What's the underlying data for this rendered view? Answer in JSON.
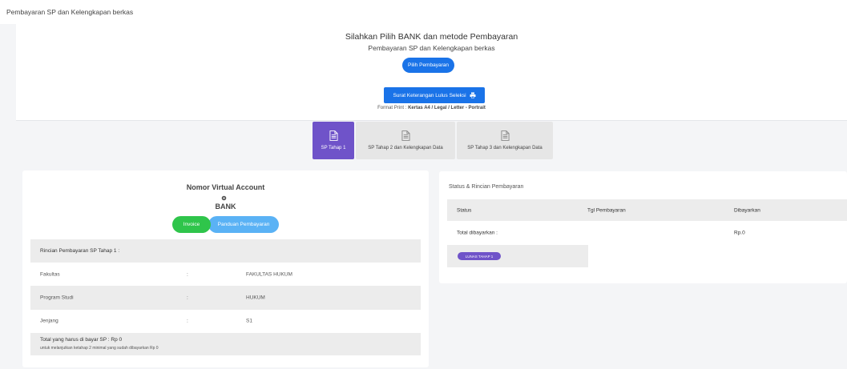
{
  "page": {
    "title": "Pembayaran SP dan Kelengkapan berkas"
  },
  "header": {
    "heading": "Silahkan Pilih BANK dan metode Pembayaran",
    "subheading": "Pembayaran SP dan Kelengkapan berkas",
    "choose_button": "Pilih Pembayaran",
    "print_button": "Surat Keterangan Lulus Seleksi",
    "format_label": "Format Print :",
    "format_value": "Kertas A4 / Legal / Letter - Portrait"
  },
  "tabs": [
    {
      "label": "SP Tahap 1",
      "active": true
    },
    {
      "label": "SP Tahap 2 dan Kelengkapan Data",
      "active": false
    },
    {
      "label": "SP Tahap 3 dan Kelengkapan Data",
      "active": false
    }
  ],
  "va_panel": {
    "title": "Nomor Virtual Account",
    "bank": "BANK",
    "invoice_button": "Invoice",
    "guide_button": "Panduan Pembayaran",
    "details_heading": "Rincian Pembayaran SP Tahap 1 :",
    "rows": [
      {
        "label": "Fakultas",
        "sep": ":",
        "value": "FAKULTAS HUKUM"
      },
      {
        "label": "Program Studi",
        "sep": ":",
        "value": "HUKUM"
      },
      {
        "label": "Jenjang",
        "sep": ":",
        "value": "S1"
      }
    ],
    "total_label": "Total yang harus di bayar SP : Rp 0",
    "total_note": "untuk melanjutkan ketahap 2 minimal yang sudah dibayarkan Rp 0"
  },
  "status_panel": {
    "title": "Status & Rincian Pembayaran",
    "columns": [
      "Status",
      "Tgl Pembayaran",
      "Dibayarkan"
    ],
    "total_label": "Total dibayarkan :",
    "total_value": "Rp.0",
    "badge": "LUNAS TAHAP 1"
  },
  "colors": {
    "primary": "#1a73e8",
    "purple": "#6f53c9",
    "green": "#2fc54b",
    "light_blue": "#5ab2f5"
  }
}
